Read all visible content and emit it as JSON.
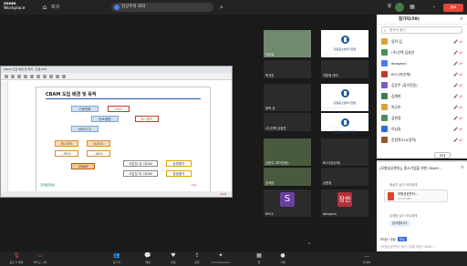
{
  "titlebar": {
    "logo_line1": "zoom",
    "logo_line2": "Workplace",
    "home_label": "회의",
    "meeting_title": "현상주의 회의",
    "search_icon": "search-icon"
  },
  "shared_screen": {
    "window_title": "CBAM 도입 배경 및 목적 - 한셀 PDF",
    "slide_title": "CBAM 도입 배경 및 목적",
    "boxes": {
      "b1": "기후변화",
      "b2": "ESG",
      "b3": "탄소중립",
      "b4": "EU 평가",
      "b5": "UNFCCC",
      "b6": "EU ETS",
      "b7": "K-ETS",
      "b8": "-55%",
      "b9": "-40%",
      "b10": "CBAM",
      "b11": "사업장 내 CBAM",
      "b12": "사업장 외 CBAM",
      "b13": "공정평가",
      "b14": "공정평가"
    },
    "footer_left": "한국품질재단",
    "footer_right": "kpe",
    "status_right": "1/24"
  },
  "videos": [
    {
      "name": "이남일",
      "kind": "camera"
    },
    {
      "name": "지방청 데이",
      "kind": "logo",
      "caption": "강원중소벤처기업청"
    },
    {
      "name": "박규호",
      "kind": "blank"
    },
    {
      "name": "지방청 데이",
      "kind": "blank"
    },
    {
      "name": "동락 김",
      "kind": "blank"
    },
    {
      "name": "강원중소벤처기업청",
      "kind": "logo",
      "caption": "강원중소벤처기업청"
    },
    {
      "name": "(주)인택 김효연",
      "kind": "blank"
    },
    {
      "name": "RCC(본순재)",
      "kind": "logo",
      "caption": "강원중소벤처기업청"
    },
    {
      "name": "김윤주 (휴이진동)",
      "kind": "photo"
    },
    {
      "name": "RCC(본순재)",
      "kind": "blank"
    },
    {
      "name": "김재완",
      "kind": "photo"
    },
    {
      "name": "심현경",
      "kind": "blank"
    },
    {
      "name": "KPC2",
      "kind": "initial",
      "initial": "S",
      "color": "#6b3fa0"
    },
    {
      "name": "dongeun",
      "kind": "initial",
      "initial": "장한",
      "color": "#b5303a"
    }
  ],
  "participants_panel": {
    "title": "참가자(59)",
    "search_placeholder": "참가자 찾기",
    "items": [
      {
        "name": "동락 김",
        "color": "#d9a23b"
      },
      {
        "name": "(주)인택 김효연",
        "color": "#4a8f5c"
      },
      {
        "name": "dongeun",
        "color": "#4c7cf3"
      },
      {
        "name": "RCC(본순재)",
        "color": "#c0392b"
      },
      {
        "name": "김윤주 (휴이진동)",
        "color": "#7a5cc0"
      },
      {
        "name": "김재완",
        "color": "#3f7d4c"
      },
      {
        "name": "박규호",
        "color": "#d9a23b"
      },
      {
        "name": "심현경",
        "color": "#4a8f5c"
      },
      {
        "name": "이남일",
        "color": "#2d6ee0"
      },
      {
        "name": "진정혁스(노정혁)",
        "color": "#8b5a2b"
      }
    ],
    "more_label": "초대"
  },
  "chat": {
    "title": "[모험성공편의]) 중소기업을 위한 CBAM...",
    "msg1_sender": "현상주 님이 모두에게",
    "file_name": "모험성공편의...",
    "file_size": "15.27 MB",
    "msg2_sender": "김재완 님이 모두에게",
    "msg2_text": "감사합니다",
    "to_label": "보내는 대상:",
    "to_value": "모두",
    "input_placeholder": "[모험성공편의] 중소기업을 위한 CBAM..."
  },
  "toolbar": {
    "items": [
      {
        "label": "음소거 해제",
        "icon": "mic-muted-icon",
        "red": true
      },
      {
        "label": "비디오 시작",
        "icon": "video-off-icon",
        "red": true
      },
      {
        "label": "참가자",
        "icon": "participants-icon",
        "red": false
      },
      {
        "label": "채팅",
        "icon": "chat-icon",
        "red": false
      },
      {
        "label": "반응",
        "icon": "heart-icon",
        "red": false
      },
      {
        "label": "공유",
        "icon": "share-icon",
        "red": false
      },
      {
        "label": "AI Companion",
        "icon": "sparkle-icon",
        "red": false
      },
      {
        "label": "앱",
        "icon": "apps-icon",
        "red": false
      },
      {
        "label": "기록",
        "icon": "record-icon",
        "red": false
      },
      {
        "label": "자세히",
        "icon": "more-icon",
        "red": false
      }
    ],
    "end_label": "종료"
  },
  "colors": {
    "bg": "#1a1a1a",
    "bar": "#232323",
    "accent": "#2d6ee0",
    "danger": "#e5483b"
  }
}
